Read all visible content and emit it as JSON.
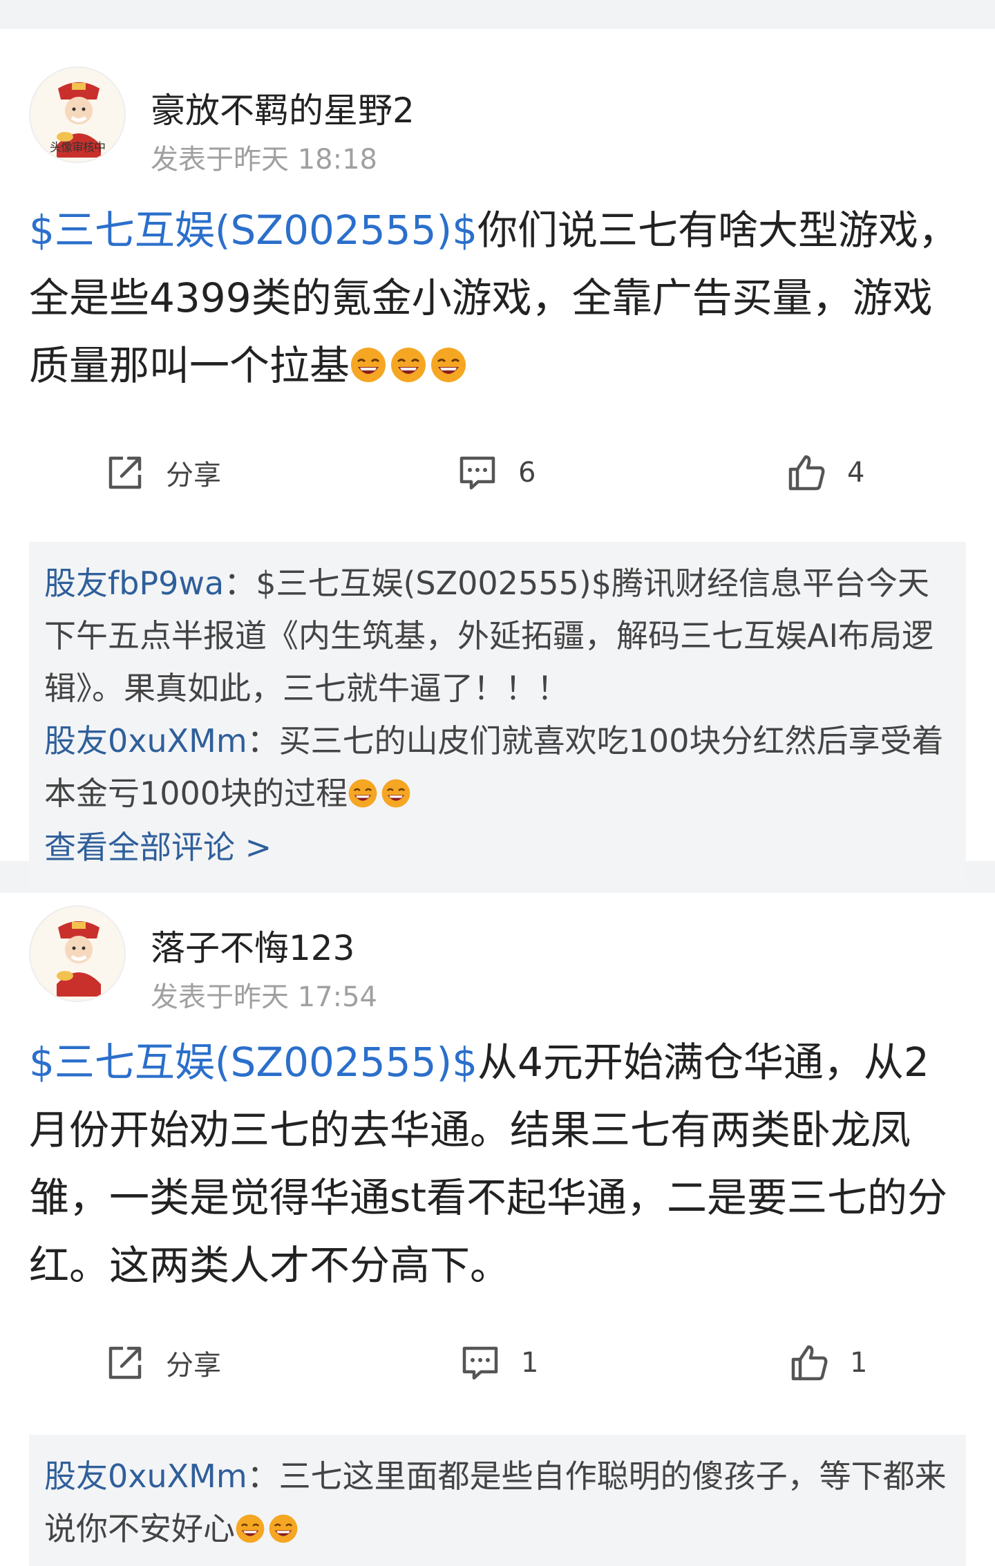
{
  "posts": [
    {
      "username": "豪放不羁的星野2",
      "avatar_caption": "头像审核中",
      "timestamp": "发表于昨天 18:18",
      "stock_tag": "$三七互娱(SZ002555)$",
      "content": "你们说三七有啥大型游戏，全是些4399类的氪金小游戏，全靠广告买量，游戏质量那叫一个拉基",
      "emoji_count": 3,
      "share_label": "分享",
      "comment_count": "6",
      "like_count": "4",
      "comments": [
        {
          "author": "股友fbP9wa",
          "separator": "：",
          "text": "$三七互娱(SZ002555)$腾讯财经信息平台今天下午五点半报道《内生筑基，外延拓疆，解码三七互娱AI布局逻辑》。果真如此，三七就牛逼了！！！"
        },
        {
          "author": "股友0xuXMm",
          "separator": "：",
          "text": "买三七的山皮们就喜欢吃100块分红然后享受着本金亏1000块的过程"
        }
      ],
      "view_all_label": "查看全部评论 >"
    },
    {
      "username": "落子不悔123",
      "timestamp": "发表于昨天 17:54",
      "stock_tag": "$三七互娱(SZ002555)$",
      "content": "从4元开始满仓华通，从2月份开始劝三七的去华通。结果三七有两类卧龙凤雏，一类是觉得华通st看不起华通，二是要三七的分红。这两类人才不分高下。",
      "share_label": "分享",
      "comment_count": "1",
      "like_count": "1",
      "comments": [
        {
          "author": "股友0xuXMm",
          "separator": "：",
          "text": "三七这里面都是些自作聪明的傻孩子，等下都来说你不安好心"
        }
      ]
    }
  ],
  "icons": {
    "share": "share-icon",
    "comment": "comment-icon",
    "like": "thumbs-up-icon",
    "emoji": "laughing-emoji-icon",
    "avatar": "fortune-god-avatar"
  },
  "colors": {
    "link": "#2b6fcb",
    "commenter": "#2f5f9a",
    "timestamp": "#a0a0a0",
    "comment_bg": "#f3f4f6",
    "page_bg": "#f2f3f5"
  }
}
